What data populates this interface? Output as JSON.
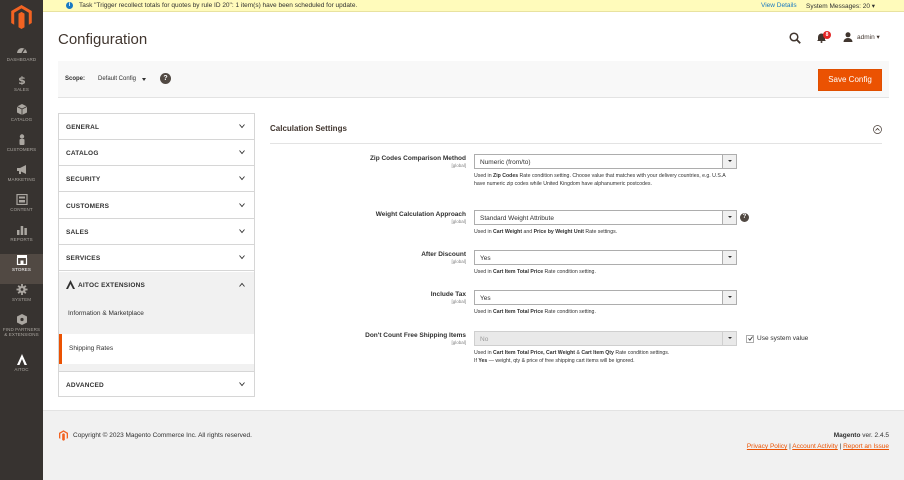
{
  "nav": {
    "items": [
      {
        "label": "DASHBOARD",
        "icon": "dashboard-icon"
      },
      {
        "label": "SALES",
        "icon": "dollar-icon"
      },
      {
        "label": "CATALOG",
        "icon": "cube-icon"
      },
      {
        "label": "CUSTOMERS",
        "icon": "person-icon"
      },
      {
        "label": "MARKETING",
        "icon": "megaphone-icon"
      },
      {
        "label": "CONTENT",
        "icon": "layout-icon"
      },
      {
        "label": "REPORTS",
        "icon": "bar-chart-icon"
      },
      {
        "label": "STORES",
        "icon": "store-icon"
      },
      {
        "label": "SYSTEM",
        "icon": "gear-icon"
      },
      {
        "label1": "FIND PARTNERS",
        "label2": "& EXTENSIONS",
        "icon": "partners-icon"
      },
      {
        "label": "AITOC",
        "icon": "aitoc-icon"
      }
    ]
  },
  "notice": {
    "message": "Task \"Trigger recollect totals for quotes by rule ID 20\": 1 item(s) have been scheduled for update.",
    "view_details": "View Details",
    "system_messages": "System Messages: 20"
  },
  "header": {
    "title": "Configuration",
    "notifications_count": "8",
    "user": "admin"
  },
  "scope": {
    "label": "Scope:",
    "value": "Default Config",
    "help": "?",
    "save_label": "Save Config"
  },
  "tabs": {
    "general": "GENERAL",
    "catalog": "CATALOG",
    "security": "SECURITY",
    "customers": "CUSTOMERS",
    "sales": "SALES",
    "services": "SERVICES",
    "aitoc": "AITOC EXTENSIONS",
    "sub_info": "Information & Marketplace",
    "sub_shipping": "Shipping Rates",
    "advanced": "ADVANCED"
  },
  "section": {
    "title": "Calculation Settings"
  },
  "fields": {
    "zip": {
      "label": "Zip Codes Comparison Method",
      "scope": "[global]",
      "value": "Numeric (from/to)",
      "note_pre": "Used in ",
      "note_b1": "Zip Codes",
      "note_post": " Rate condition setting. Choose value that matches with your delivery countries, e.g. U.S.A have numeric zip codes while United Kingdom have alphanumeric postcodes."
    },
    "weight": {
      "label": "Weight Calculation Approach",
      "scope": "[global]",
      "value": "Standard Weight Attribute",
      "help": "?",
      "note_pre": "Used in ",
      "note_b1": "Cart Weight",
      "note_mid": " and ",
      "note_b2": "Price by Weight Unit",
      "note_post": " Rate settings."
    },
    "after_discount": {
      "label": "After Discount",
      "scope": "[global]",
      "value": "Yes",
      "note_pre": "Used in ",
      "note_b1": "Cart Item Total Price",
      "note_post": " Rate condition setting."
    },
    "include_tax": {
      "label": "Include Tax",
      "scope": "[global]",
      "value": "Yes",
      "note_pre": "Used in ",
      "note_b1": "Cart Item Total Price",
      "note_post": " Rate condition setting."
    },
    "free_shipping": {
      "label": "Don't Count Free Shipping Items",
      "scope": "[global]",
      "value": "No",
      "use_system": "Use system value",
      "note_pre": "Used in ",
      "note_b1": "Cart Item Total Price, Cart Weight",
      "note_mid": " & ",
      "note_b2": "Cart Item Qty",
      "note_post": " Rate condition settings.",
      "note2_pre": "If ",
      "note2_b": "Yes",
      "note2_post": " — weight, qty & price of free shipping cart items will be ignored."
    }
  },
  "footer": {
    "copyright": "Copyright © 2023 Magento Commerce Inc. All rights reserved.",
    "brand": "Magento",
    "version": " ver. 2.4.5",
    "privacy": "Privacy Policy",
    "activity": "Account Activity",
    "report": "Report an Issue",
    "sep": " | "
  },
  "colors": {
    "accent": "#eb5202",
    "nav_bg": "#373330",
    "link": "#1979c3"
  }
}
